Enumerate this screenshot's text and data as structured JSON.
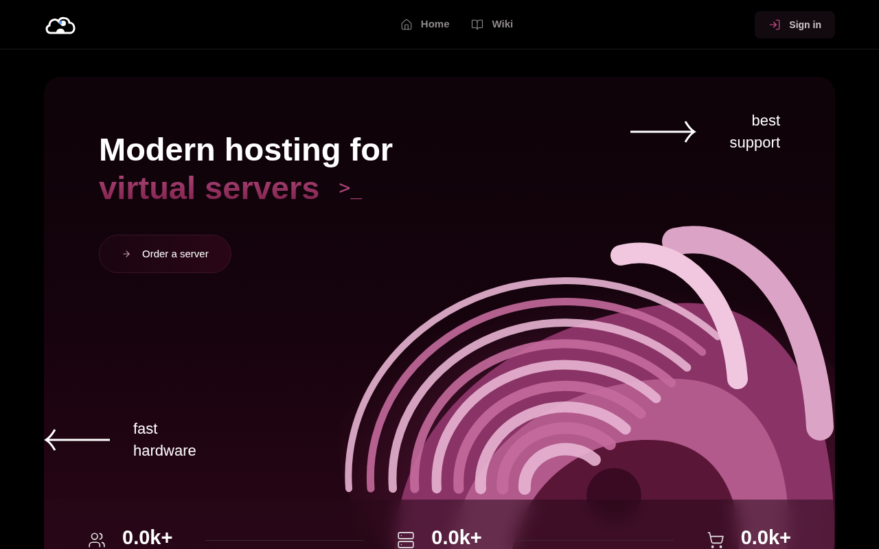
{
  "nav": {
    "links": [
      {
        "label": "Home"
      },
      {
        "label": "Wiki"
      }
    ],
    "sign_in": "Sign in"
  },
  "hero": {
    "title": "Modern hosting for",
    "highlight": "virtual servers",
    "prompt": ">_",
    "cta": "Order a server",
    "note_right": "best support",
    "note_left": "fast hardware"
  },
  "stats": [
    {
      "value": "0.0k+"
    },
    {
      "value": "0.0k+"
    },
    {
      "value": "0.0k+"
    }
  ]
}
